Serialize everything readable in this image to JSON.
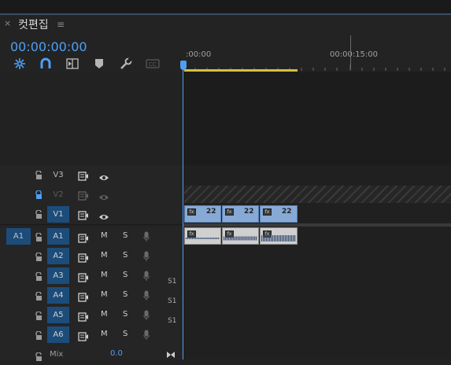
{
  "sequence": {
    "title": "컷편집",
    "timecode": "00:00:00:00"
  },
  "ruler": {
    "labels": [
      ":00:00",
      "00:00:15:00"
    ]
  },
  "video_tracks": [
    {
      "name": "V3",
      "locked_label": "",
      "active": false,
      "src": ""
    },
    {
      "name": "V2",
      "locked_label": "",
      "active": false,
      "src": ""
    },
    {
      "name": "V1",
      "locked_label": "",
      "active": true,
      "src": ""
    }
  ],
  "audio_tracks": [
    {
      "name": "A1",
      "src": "A1",
      "m": "M",
      "s": "S",
      "s1": ""
    },
    {
      "name": "A2",
      "src": "",
      "m": "M",
      "s": "S",
      "s1": ""
    },
    {
      "name": "A3",
      "src": "",
      "m": "M",
      "s": "S",
      "s1": ""
    },
    {
      "name": "A4",
      "src": "",
      "m": "M",
      "s": "S",
      "s1": "S1"
    },
    {
      "name": "A5",
      "src": "",
      "m": "M",
      "s": "S",
      "s1": "S1"
    },
    {
      "name": "A6",
      "src": "",
      "m": "M",
      "s": "S",
      "s1": "S1"
    }
  ],
  "mix": {
    "label": "Mix",
    "value": "0.0"
  },
  "clips": {
    "video_label": "22"
  },
  "colors": {
    "accent": "#4e9ff5",
    "video_clip": "#86a9d6",
    "audio_clip": "#cfcfcf",
    "work_area": "#d4c13a",
    "track_active": "#1c4c7a"
  },
  "icons": [
    "close-icon",
    "hamburger-menu-icon",
    "snap-icon",
    "magnet-link-icon",
    "insert-edit-icon",
    "marker-icon",
    "wrench-icon",
    "captions-icon",
    "lock-icon",
    "film-icon",
    "eye-icon",
    "mic-icon",
    "fx-icon"
  ]
}
